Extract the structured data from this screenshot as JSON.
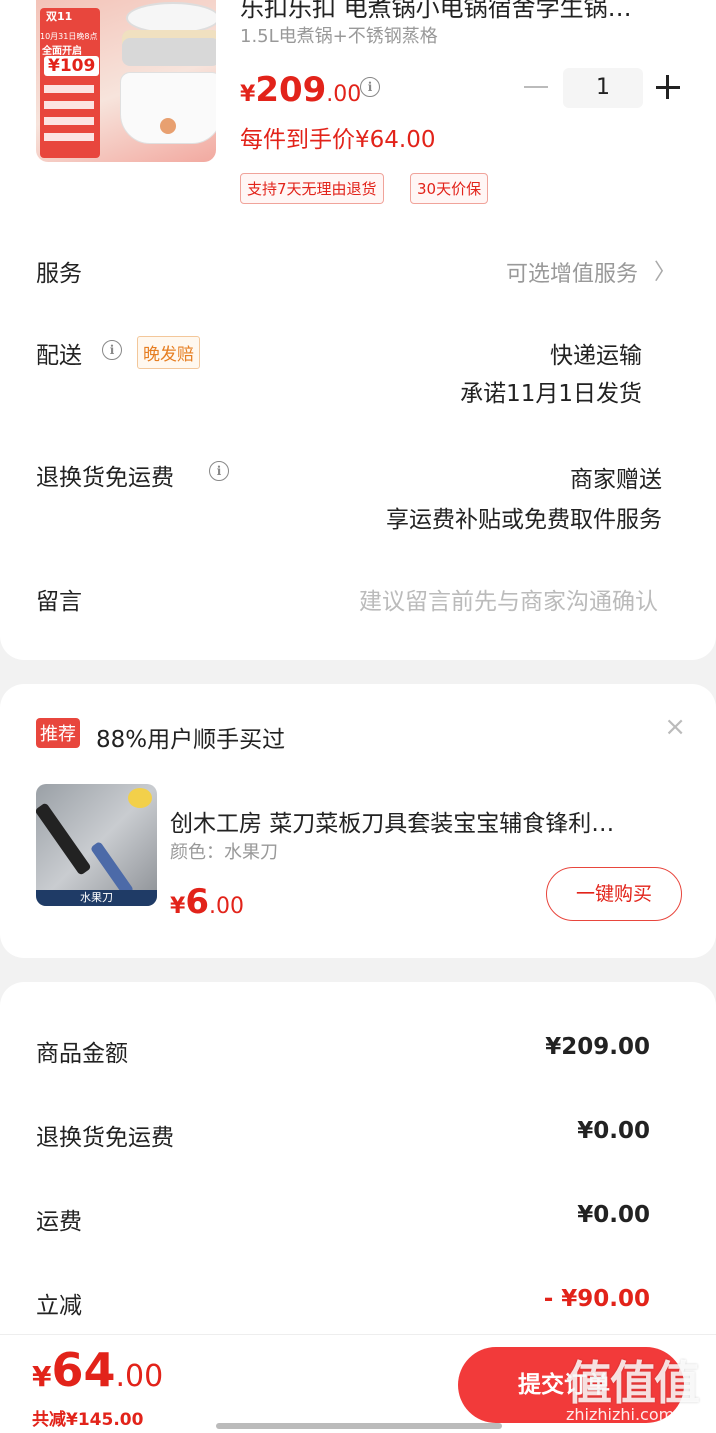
{
  "product": {
    "title": "乐扣乐扣 电煮锅小电锅宿舍学生锅…",
    "spec": "1.5L电煮锅+不锈钢蒸格",
    "price_symbol": "¥",
    "price_int": "209",
    "price_dec": ".00",
    "final_price_text": "每件到手价¥64.00",
    "quantity": "1",
    "tags": [
      "支持7天无理由退货",
      "30天价保"
    ],
    "image_text": {
      "top": "双11",
      "sub": "10月31日晚8点",
      "badge": "全面开启",
      "price": "¥109"
    }
  },
  "service": {
    "label": "服务",
    "value": "可选增值服务"
  },
  "delivery": {
    "label": "配送",
    "badge": "晚发赔",
    "method": "快递运输",
    "promise": "承诺11月1日发货"
  },
  "return_shipping": {
    "label": "退换货免运费",
    "value": "商家赠送",
    "desc": "享运费补贴或免费取件服务"
  },
  "message": {
    "label": "留言",
    "placeholder": "建议留言前先与商家沟通确认"
  },
  "recommend": {
    "badge": "推荐",
    "title": "88%用户顺手买过",
    "item_title": "创木工房 菜刀菜板刀具套装宝宝辅食锋利…",
    "item_spec": "颜色：水果刀",
    "price_symbol": "¥",
    "price_int": "6",
    "price_dec": ".00",
    "buy_label": "一键购买",
    "image_caption": "水果刀"
  },
  "summary": {
    "rows": [
      {
        "label": "商品金额",
        "value": "¥209.00"
      },
      {
        "label": "退换货免运费",
        "value": "¥0.00"
      },
      {
        "label": "运费",
        "value": "¥0.00"
      },
      {
        "label": "立减",
        "value": "- ¥90.00"
      }
    ]
  },
  "bottom": {
    "price_symbol": "¥",
    "price_int": "64",
    "price_dec": ".00",
    "total_discount": "共减¥145.00",
    "submit_label": "提交订单",
    "watermark": "值值值",
    "watermark_url": "zhizhizhi.com"
  },
  "colors": {
    "accent": "#e2231a",
    "submit": "#f23a3a"
  }
}
